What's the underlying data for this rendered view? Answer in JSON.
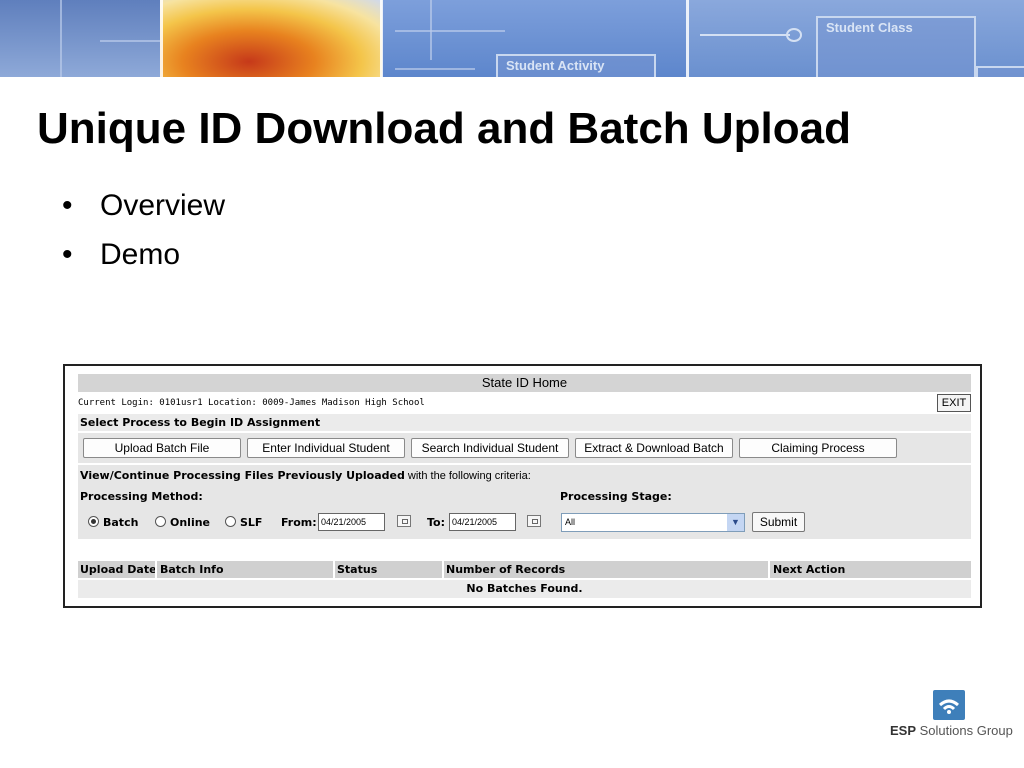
{
  "banner": {
    "label_student_class": "Student Class",
    "label_student_activity": "Student Activity"
  },
  "slide": {
    "title": "Unique ID Download and Batch Upload",
    "bullets": [
      "Overview",
      "Demo"
    ],
    "bullet_glyph": "•"
  },
  "app": {
    "header_title": "State ID Home",
    "login_text": "Current Login: 0101usr1 Location: 0009-James Madison High School",
    "exit_label": "EXIT",
    "select_process_heading": "Select Process to Begin ID Assignment",
    "process_buttons": [
      "Upload Batch File",
      "Enter Individual Student",
      "Search Individual Student",
      "Extract & Download Batch",
      "Claiming Process"
    ],
    "criteria": {
      "heading_bold": "View/Continue Processing Files Previously Uploaded",
      "heading_rest": " with the following criteria:",
      "processing_method_label": "Processing Method:",
      "processing_stage_label": "Processing Stage:",
      "methods": [
        {
          "label": "Batch",
          "selected": true
        },
        {
          "label": "Online",
          "selected": false
        },
        {
          "label": "SLF",
          "selected": false
        }
      ],
      "from_label": "From:",
      "from_value": "04/21/2005",
      "to_label": "To:",
      "to_value": "04/21/2005",
      "stage_value": "All",
      "submit_label": "Submit"
    },
    "table": {
      "columns": [
        "Upload Date",
        "Batch Info",
        "Status",
        "Number of Records",
        "Next Action"
      ],
      "empty_message": "No Batches Found."
    }
  },
  "logo": {
    "brand": "ESP",
    "name": "Solutions Group",
    "color": "#3e7fba"
  },
  "icons": {
    "calendar": "calendar-icon",
    "dropdown": "chevron-down-icon",
    "logo_mark": "esp-logo-icon"
  }
}
